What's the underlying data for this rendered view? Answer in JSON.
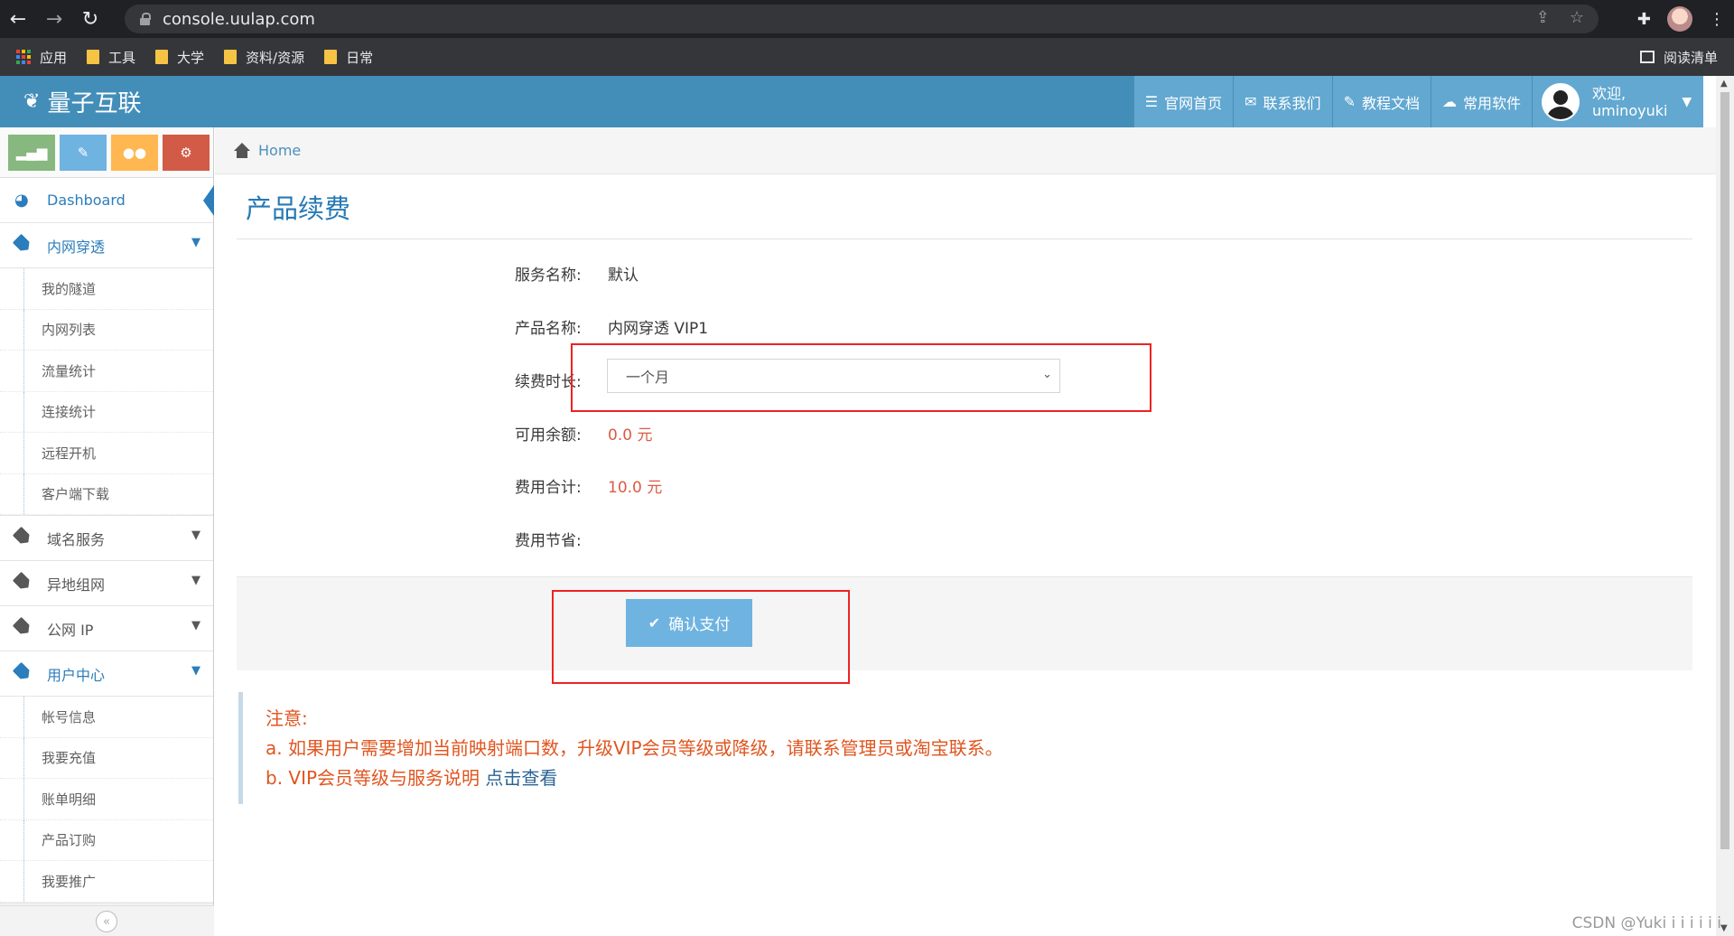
{
  "browser": {
    "url": "console.uulap.com",
    "bookmarks": [
      {
        "label": "应用"
      },
      {
        "label": "工具"
      },
      {
        "label": "大学"
      },
      {
        "label": "资料/资源"
      },
      {
        "label": "日常"
      }
    ],
    "reading_list": "阅读清单"
  },
  "header": {
    "brand": "量子互联",
    "nav": [
      {
        "label": "官网首页"
      },
      {
        "label": "联系我们"
      },
      {
        "label": "教程文档"
      },
      {
        "label": "常用软件"
      }
    ],
    "welcome": "欢迎,",
    "username": "uminoyuki"
  },
  "sidebar": {
    "dashboard": "Dashboard",
    "groups": [
      {
        "label": "内网穿透",
        "items": [
          "我的隧道",
          "内网列表",
          "流量统计",
          "连接统计",
          "远程开机",
          "客户端下载"
        ]
      },
      {
        "label": "域名服务"
      },
      {
        "label": "异地组网"
      },
      {
        "label": "公网 IP"
      },
      {
        "label": "用户中心",
        "items": [
          "帐号信息",
          "我要充值",
          "账单明细",
          "产品订购",
          "我要推广"
        ]
      }
    ]
  },
  "breadcrumb": {
    "home": "Home"
  },
  "main": {
    "title": "产品续费",
    "fields": [
      {
        "label": "服务名称:",
        "value": "默认"
      },
      {
        "label": "产品名称:",
        "value": "内网穿透 VIP1"
      },
      {
        "label": "续费时长:",
        "value": "一个月"
      },
      {
        "label": "可用余额:",
        "value": "0.0 元"
      },
      {
        "label": "费用合计:",
        "value": "10.0 元"
      },
      {
        "label": "费用节省:",
        "value": ""
      }
    ],
    "pay_button": "确认支付"
  },
  "notice": {
    "title": "注意:",
    "line_a": "a. 如果用户需要增加当前映射端口数，升级VIP会员等级或降级，请联系管理员或淘宝联系。",
    "line_b": "b. VIP会员等级与服务说明 ",
    "line_b_link": "点击查看"
  },
  "watermark": "CSDN @Yuki i i i i i i"
}
